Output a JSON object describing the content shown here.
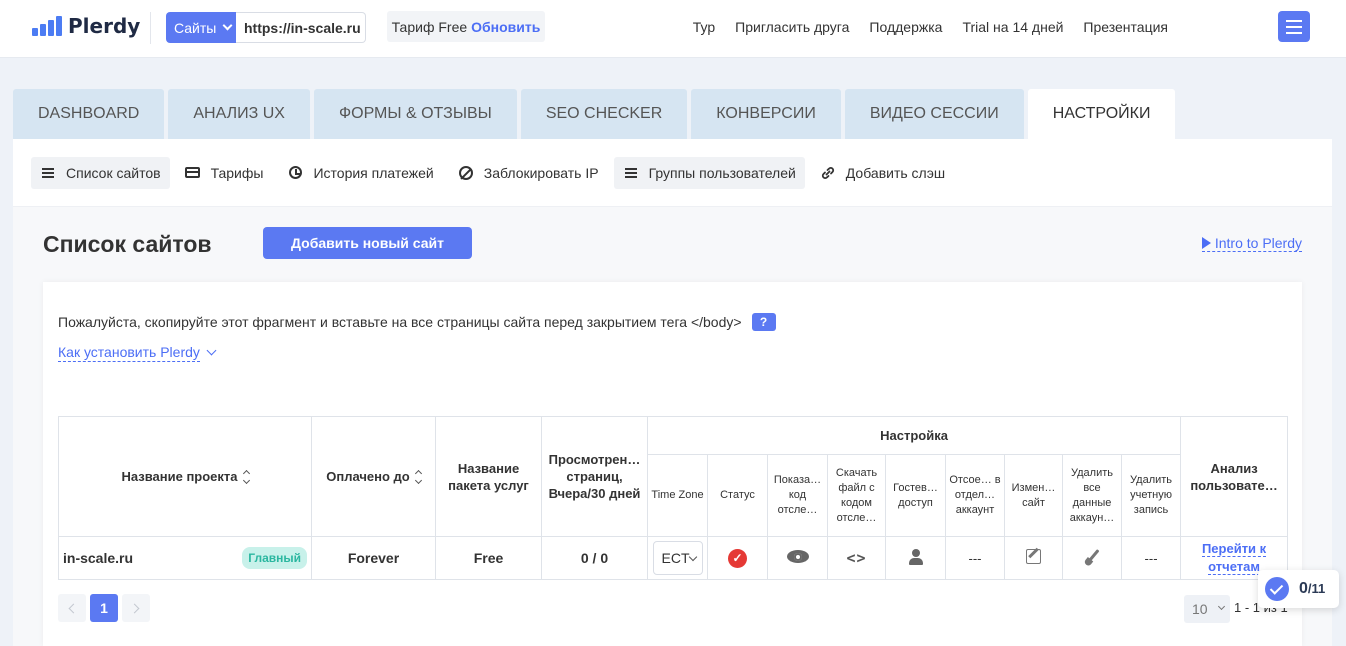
{
  "brand": {
    "name": "Plerdy"
  },
  "site_select": {
    "label": "Сайты",
    "url": "https://in-scale.ru"
  },
  "tariff": {
    "label": "Тариф Free",
    "upgrade": "Обновить"
  },
  "top_nav": [
    "Тур",
    "Пригласить друга",
    "Поддержка",
    "Trial на 14 дней",
    "Презентация"
  ],
  "tabs": [
    "DASHBOARD",
    "АНАЛИЗ UX",
    "ФОРМЫ & ОТЗЫВЫ",
    "SEO CHECKER",
    "КОНВЕРСИИ",
    "ВИДЕО СЕССИИ",
    "НАСТРОЙКИ"
  ],
  "active_tab": "НАСТРОЙКИ",
  "subnav": [
    {
      "label": "Список сайтов",
      "icon": "list-icon"
    },
    {
      "label": "Тарифы",
      "icon": "credit-card-icon"
    },
    {
      "label": "История платежей",
      "icon": "history-icon"
    },
    {
      "label": "Заблокировать IP",
      "icon": "block-icon"
    },
    {
      "label": "Группы пользователей",
      "icon": "list-icon"
    },
    {
      "label": "Добавить слэш",
      "icon": "link-icon"
    }
  ],
  "main": {
    "title": "Список сайтов",
    "add_button": "Добавить новый сайт",
    "intro_link": "Intro to Plerdy",
    "instruction": "Пожалуйста, скопируйте этот фрагмент и вставьте на все страницы сайта перед закрытием тега </body>",
    "help_label": "?",
    "howto_link": "Как установить Plerdy"
  },
  "table": {
    "headers": {
      "project": "Название проекта",
      "paid_until": "Оплачено до",
      "package": "Название пакета услуг",
      "pages_viewed": "Просмотрен… страниц, Вчера/30 дней",
      "settings": "Настройка",
      "analysis": "Анализ пользовате…"
    },
    "subheaders": {
      "timezone": "Time Zone",
      "status": "Статус",
      "show_code": "Показа… код отсле…",
      "download": "Скачать файл с кодом отсле…",
      "guest": "Гостев… доступ",
      "separate": "Отсое… в отдел… аккаунт",
      "edit": "Измен… сайт",
      "delete_data": "Удалить все данные аккаун…",
      "delete_record": "Удалить учетную запись"
    },
    "row": {
      "project": "in-scale.ru",
      "badge": "Главный",
      "paid_until": "Forever",
      "package": "Free",
      "pages_viewed": "0 / 0",
      "timezone": "ECT",
      "separate": "---",
      "delete_record": "---",
      "analysis_link": "Перейти к отчетам"
    }
  },
  "pagination": {
    "current": "1",
    "per_page": "10",
    "range": "1 - 1 из 1"
  },
  "progress_widget": {
    "done": "0",
    "total": "/11"
  },
  "colors": {
    "accent": "#5b79f2",
    "status_red": "#e53935",
    "badge_bg": "#c8f1ea",
    "badge_text": "#2bb7a0"
  }
}
